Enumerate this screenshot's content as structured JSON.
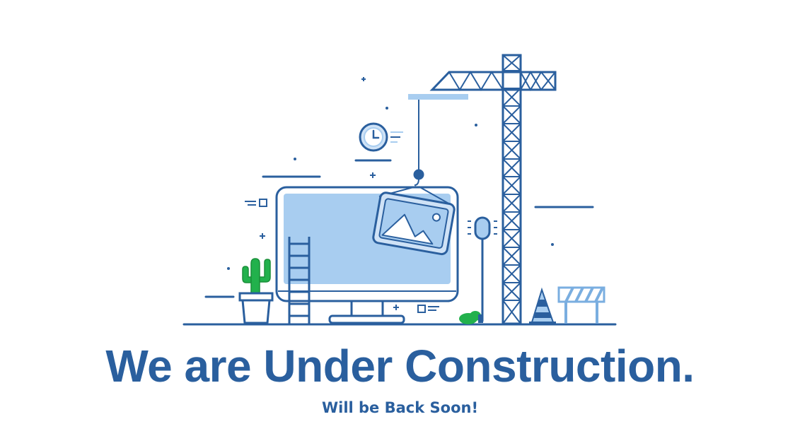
{
  "headline": {
    "part1": "We are Under",
    "part2": "Construction."
  },
  "subline": "Will be Back Soon!",
  "colors": {
    "primary": "#2a5f9e",
    "light_blue": "#a8cdf0",
    "mid_blue": "#7aaee0",
    "cactus_green": "#22b14c",
    "background": "#ffffff"
  },
  "icons": [
    "crane-icon",
    "monitor-icon",
    "picture-frame-icon",
    "clock-icon",
    "cactus-icon",
    "ladder-icon",
    "traffic-cone-icon",
    "barrier-icon",
    "lamp-post-icon",
    "bush-icon"
  ]
}
